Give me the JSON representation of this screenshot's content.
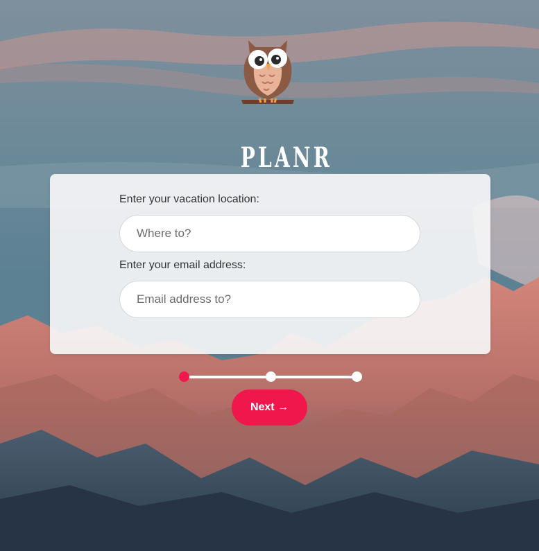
{
  "brand": {
    "name": "PLANR",
    "logo_icon": "owl-icon"
  },
  "form": {
    "location_label": "Enter your vacation location:",
    "location_placeholder": "Where to?",
    "location_value": "",
    "email_label": "Enter your email address:",
    "email_placeholder": "Email address to?",
    "email_value": ""
  },
  "progress": {
    "total_steps": 3,
    "current_step": 1
  },
  "actions": {
    "next_label": "Next →"
  },
  "colors": {
    "accent": "#f0174c",
    "card_background": "#f6f6f7",
    "text": "#333333",
    "placeholder": "#6b6b6b"
  }
}
